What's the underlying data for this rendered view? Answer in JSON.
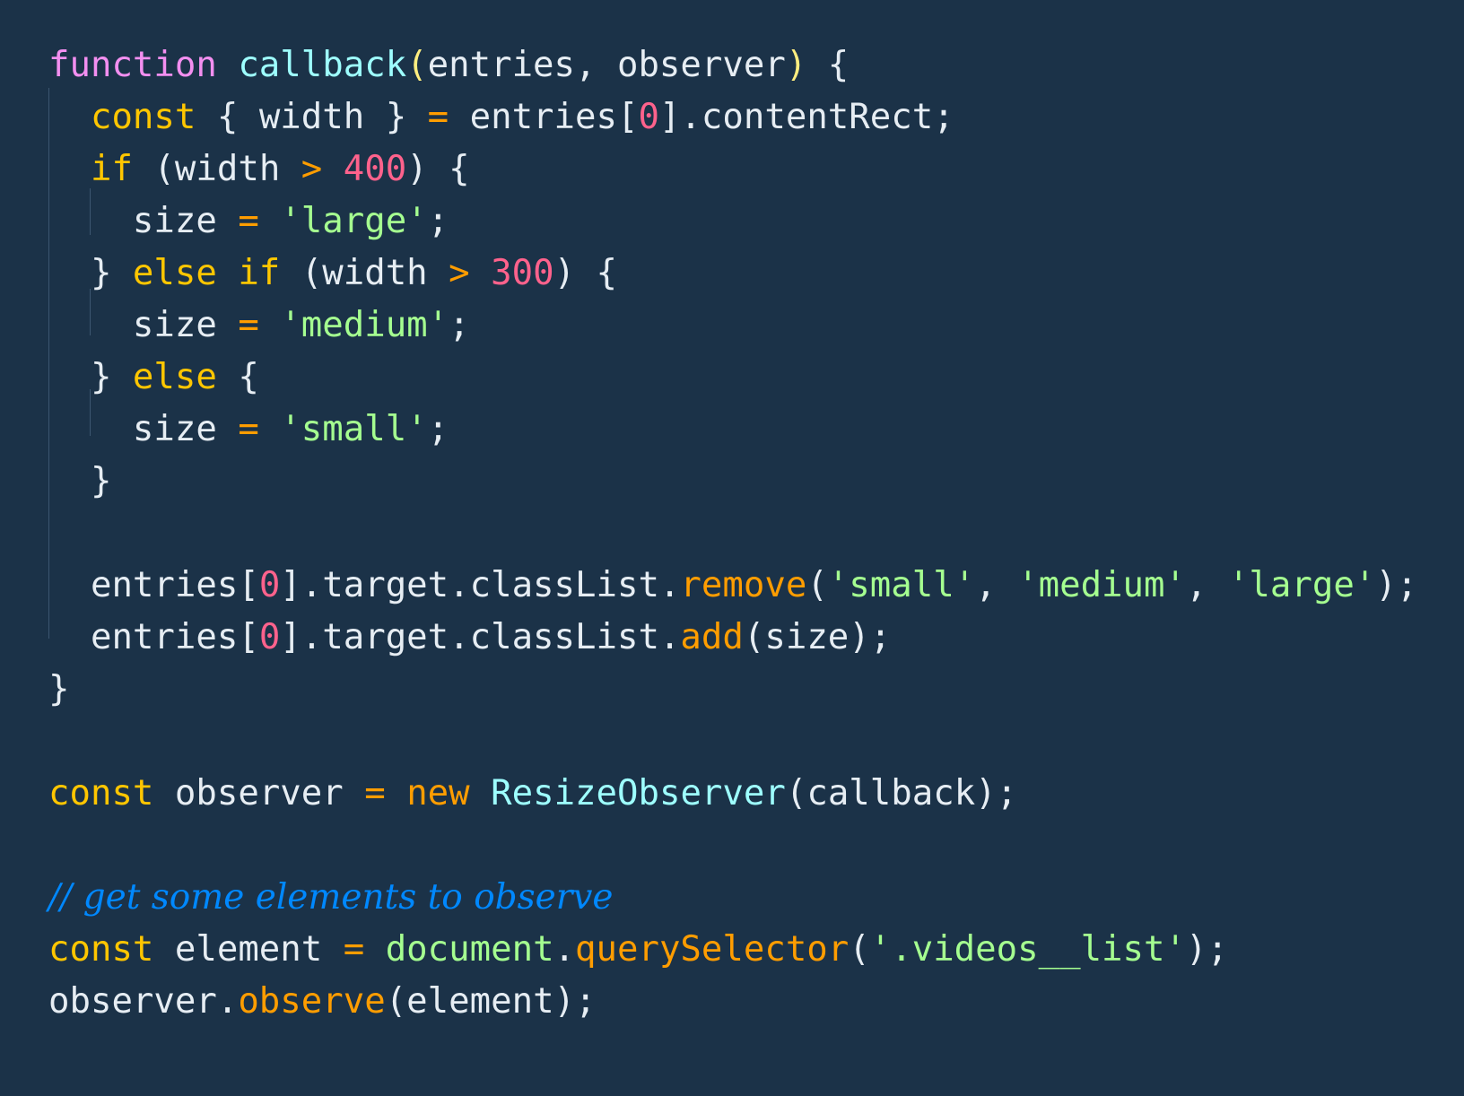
{
  "colors": {
    "background": "#1b3248",
    "keyword_pink": "#f38ff0",
    "keyword_yellow": "#ffc600",
    "keyword_orange": "#ff9d00",
    "function_cyan": "#9effff",
    "string_green": "#a5ff90",
    "number_pink": "#ff628c",
    "comment_blue": "#0088ff",
    "plain_text": "#e6edf3"
  },
  "lines": [
    [
      {
        "t": "function",
        "c": "kw-pink"
      },
      {
        "t": " ",
        "c": "plain"
      },
      {
        "t": "callback",
        "c": "fn-cyan"
      },
      {
        "t": "(",
        "c": "paren-yellow"
      },
      {
        "t": "entries, observer",
        "c": "plain"
      },
      {
        "t": ")",
        "c": "paren-yellow"
      },
      {
        "t": " {",
        "c": "plain"
      }
    ],
    [
      {
        "t": "  ",
        "c": "plain"
      },
      {
        "t": "const",
        "c": "kw-yellow"
      },
      {
        "t": " { width } ",
        "c": "plain"
      },
      {
        "t": "=",
        "c": "op"
      },
      {
        "t": " entries[",
        "c": "plain"
      },
      {
        "t": "0",
        "c": "num"
      },
      {
        "t": "].contentRect;",
        "c": "plain"
      }
    ],
    [
      {
        "t": "  ",
        "c": "plain"
      },
      {
        "t": "if",
        "c": "kw-yellow"
      },
      {
        "t": " (width ",
        "c": "plain"
      },
      {
        "t": ">",
        "c": "op"
      },
      {
        "t": " ",
        "c": "plain"
      },
      {
        "t": "400",
        "c": "num"
      },
      {
        "t": ") {",
        "c": "plain"
      }
    ],
    [
      {
        "t": "    size ",
        "c": "plain"
      },
      {
        "t": "=",
        "c": "op"
      },
      {
        "t": " ",
        "c": "plain"
      },
      {
        "t": "'large'",
        "c": "str"
      },
      {
        "t": ";",
        "c": "plain"
      }
    ],
    [
      {
        "t": "  } ",
        "c": "plain"
      },
      {
        "t": "else if",
        "c": "kw-yellow"
      },
      {
        "t": " (width ",
        "c": "plain"
      },
      {
        "t": ">",
        "c": "op"
      },
      {
        "t": " ",
        "c": "plain"
      },
      {
        "t": "300",
        "c": "num"
      },
      {
        "t": ") {",
        "c": "plain"
      }
    ],
    [
      {
        "t": "    size ",
        "c": "plain"
      },
      {
        "t": "=",
        "c": "op"
      },
      {
        "t": " ",
        "c": "plain"
      },
      {
        "t": "'medium'",
        "c": "str"
      },
      {
        "t": ";",
        "c": "plain"
      }
    ],
    [
      {
        "t": "  } ",
        "c": "plain"
      },
      {
        "t": "else",
        "c": "kw-yellow"
      },
      {
        "t": " {",
        "c": "plain"
      }
    ],
    [
      {
        "t": "    size ",
        "c": "plain"
      },
      {
        "t": "=",
        "c": "op"
      },
      {
        "t": " ",
        "c": "plain"
      },
      {
        "t": "'small'",
        "c": "str"
      },
      {
        "t": ";",
        "c": "plain"
      }
    ],
    [
      {
        "t": "  }",
        "c": "plain"
      }
    ],
    [],
    [
      {
        "t": "  entries[",
        "c": "plain"
      },
      {
        "t": "0",
        "c": "num"
      },
      {
        "t": "].target.classList.",
        "c": "plain"
      },
      {
        "t": "remove",
        "c": "method"
      },
      {
        "t": "(",
        "c": "plain"
      },
      {
        "t": "'small'",
        "c": "str"
      },
      {
        "t": ", ",
        "c": "plain"
      },
      {
        "t": "'medium'",
        "c": "str"
      },
      {
        "t": ", ",
        "c": "plain"
      },
      {
        "t": "'large'",
        "c": "str"
      },
      {
        "t": ");",
        "c": "plain"
      }
    ],
    [
      {
        "t": "  entries[",
        "c": "plain"
      },
      {
        "t": "0",
        "c": "num"
      },
      {
        "t": "].target.classList.",
        "c": "plain"
      },
      {
        "t": "add",
        "c": "method"
      },
      {
        "t": "(size);",
        "c": "plain"
      }
    ],
    [
      {
        "t": "}",
        "c": "plain"
      }
    ],
    [],
    [
      {
        "t": "const",
        "c": "kw-yellow"
      },
      {
        "t": " observer ",
        "c": "plain"
      },
      {
        "t": "=",
        "c": "op"
      },
      {
        "t": " ",
        "c": "plain"
      },
      {
        "t": "new",
        "c": "kw-orange"
      },
      {
        "t": " ",
        "c": "plain"
      },
      {
        "t": "ResizeObserver",
        "c": "fn-cyan"
      },
      {
        "t": "(callback);",
        "c": "plain"
      }
    ],
    [],
    [
      {
        "t": "// get some elements to observe",
        "c": "comment"
      }
    ],
    [
      {
        "t": "const",
        "c": "kw-yellow"
      },
      {
        "t": " element ",
        "c": "plain"
      },
      {
        "t": "=",
        "c": "op"
      },
      {
        "t": " ",
        "c": "plain"
      },
      {
        "t": "document",
        "c": "fn-green"
      },
      {
        "t": ".",
        "c": "plain"
      },
      {
        "t": "querySelector",
        "c": "method"
      },
      {
        "t": "(",
        "c": "plain"
      },
      {
        "t": "'.videos__list'",
        "c": "str"
      },
      {
        "t": ");",
        "c": "plain"
      }
    ],
    [
      {
        "t": "observer.",
        "c": "plain"
      },
      {
        "t": "observe",
        "c": "method"
      },
      {
        "t": "(element);",
        "c": "plain"
      }
    ]
  ]
}
